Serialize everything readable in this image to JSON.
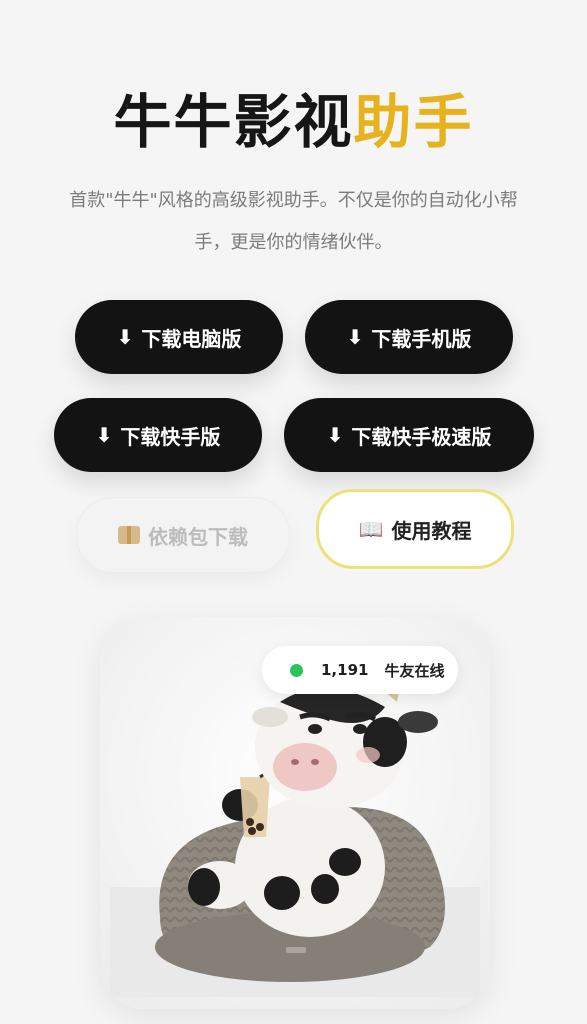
{
  "hero": {
    "title_part1": "牛牛影视",
    "title_part2": "助手",
    "subtitle_line1": "首款\"牛牛\"风格的高级影视助手。不仅是你的自动化小帮",
    "subtitle_line2": "手，更是你的情绪伙伴。"
  },
  "downloads": {
    "pc_label": "下载电脑版",
    "mobile_label": "下载手机版",
    "kuaishou_label": "下载快手版",
    "kuaishou_lite_label": "下载快手极速版",
    "deps_label": "依赖包下载",
    "tutorial_label": "使用教程"
  },
  "icons": {
    "download": "download-arrow-icon",
    "package": "package-icon",
    "book": "book-icon"
  },
  "online": {
    "count": "1,191",
    "label": "牛友在线"
  },
  "colors": {
    "accent": "#e6b31e",
    "dark_button": "#131313",
    "online_dot": "#2bc458",
    "outline": "#ece27a"
  }
}
